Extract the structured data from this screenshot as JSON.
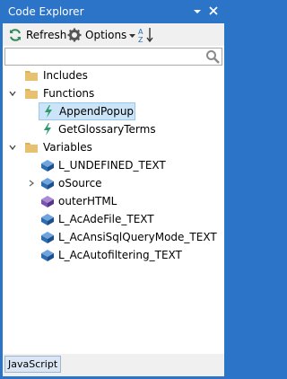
{
  "window": {
    "title": "Code Explorer"
  },
  "toolbar": {
    "refresh_label": "Refresh",
    "options_label": "Options"
  },
  "search": {
    "placeholder": ""
  },
  "tree": {
    "folders": [
      {
        "label": "Includes",
        "expanded": false,
        "children": []
      },
      {
        "label": "Functions",
        "expanded": true,
        "children": [
          {
            "label": "AppendPopup",
            "icon": "function-icon",
            "selected": true
          },
          {
            "label": "GetGlossaryTerms",
            "icon": "function-icon",
            "selected": false
          }
        ]
      },
      {
        "label": "Variables",
        "expanded": true,
        "children": [
          {
            "label": "L_UNDEFINED_TEXT",
            "icon": "variable-icon",
            "expandable": false
          },
          {
            "label": "oSource",
            "icon": "variable-icon",
            "expandable": true
          },
          {
            "label": "outerHTML",
            "icon": "property-icon",
            "expandable": false
          },
          {
            "label": "L_AcAdeFile_TEXT",
            "icon": "variable-icon",
            "expandable": false
          },
          {
            "label": "L_AcAnsiSqlQueryMode_TEXT",
            "icon": "variable-icon",
            "expandable": false
          },
          {
            "label": "L_AcAutofiltering_TEXT",
            "icon": "variable-icon",
            "expandable": false
          }
        ]
      }
    ]
  },
  "footer": {
    "language": "JavaScript"
  },
  "colors": {
    "titlebar": "#2b74c7",
    "selection": "#cce4f7",
    "folder": "#dcb35c"
  }
}
